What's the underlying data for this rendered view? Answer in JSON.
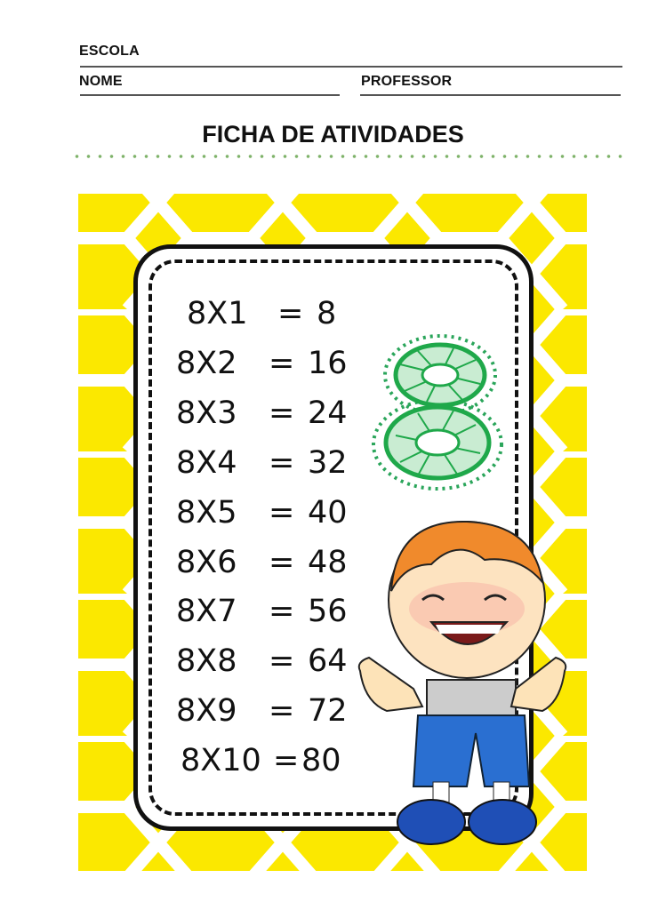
{
  "header": {
    "school_label": "ESCOLA",
    "name_label": "NOME",
    "teacher_label": "PROFESSOR",
    "title": "FICHA DE ATIVIDADES"
  },
  "table": {
    "number": "8",
    "rows": [
      {
        "expr": "8X1",
        "eq": "=",
        "result": "8"
      },
      {
        "expr": "8X2",
        "eq": "=",
        "result": "16"
      },
      {
        "expr": "8X3",
        "eq": "=",
        "result": "24"
      },
      {
        "expr": "8X4",
        "eq": "=",
        "result": "32"
      },
      {
        "expr": "8X5",
        "eq": "=",
        "result": "40"
      },
      {
        "expr": "8X6",
        "eq": "=",
        "result": "48"
      },
      {
        "expr": "8X7",
        "eq": "=",
        "result": "56"
      },
      {
        "expr": "8X8",
        "eq": "=",
        "result": "64"
      },
      {
        "expr": "8X9",
        "eq": "=",
        "result": "72"
      },
      {
        "expr": "8X10",
        "eq": "=",
        "result": "80"
      }
    ]
  },
  "colors": {
    "panel": "#fbe800",
    "accent_green": "#1fa84a",
    "dots": "#7fb36a"
  }
}
